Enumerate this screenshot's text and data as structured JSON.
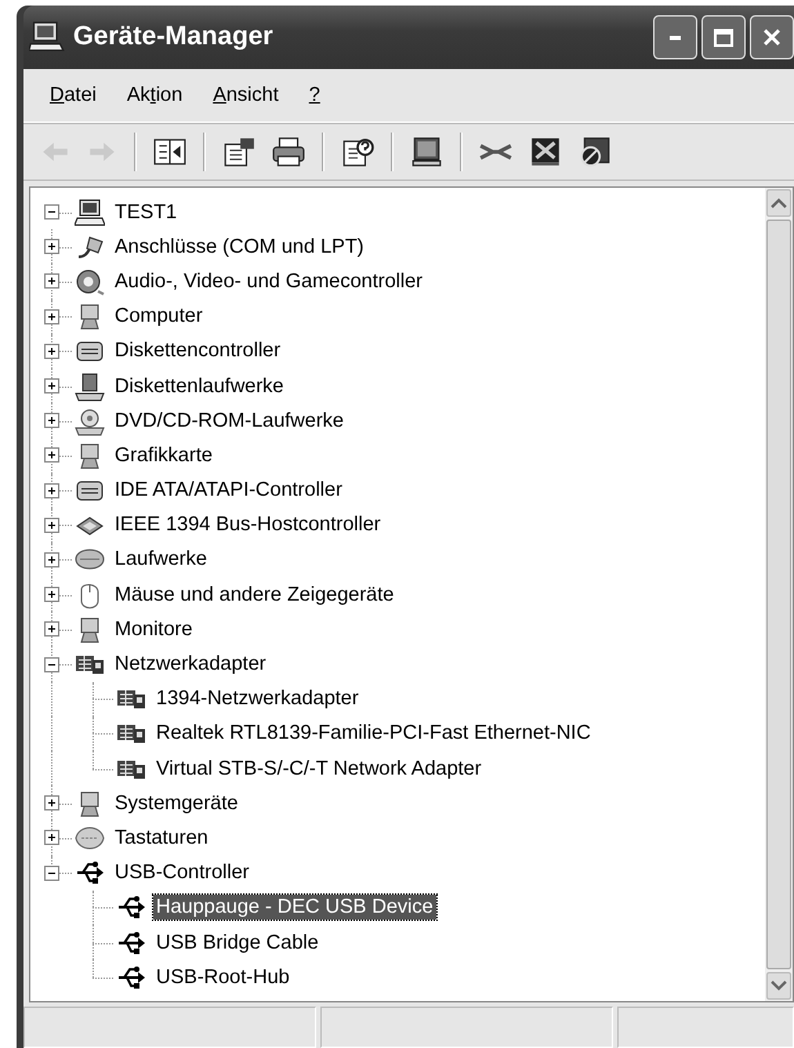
{
  "window": {
    "title": "Geräte-Manager"
  },
  "menu": [
    {
      "key": "D",
      "post": "atei"
    },
    {
      "pre": "Ak",
      "key": "t",
      "post": "ion"
    },
    {
      "key": "A",
      "post": "nsicht"
    },
    {
      "key": "?"
    }
  ],
  "toolbar": [
    {
      "kind": "back",
      "disabled": true
    },
    {
      "kind": "forward",
      "disabled": true
    },
    {
      "kind": "separator"
    },
    {
      "kind": "tree",
      "disabled": false
    },
    {
      "kind": "separator"
    },
    {
      "kind": "properties",
      "disabled": false
    },
    {
      "kind": "print",
      "disabled": false
    },
    {
      "kind": "separator"
    },
    {
      "kind": "help",
      "disabled": false
    },
    {
      "kind": "separator"
    },
    {
      "kind": "scan",
      "disabled": false
    },
    {
      "kind": "separator"
    },
    {
      "kind": "network",
      "disabled": false
    },
    {
      "kind": "uninstall",
      "disabled": false
    },
    {
      "kind": "disable",
      "disabled": false
    }
  ],
  "tree": {
    "label": "TEST1",
    "kind": "computer",
    "expanded": true,
    "selected": false,
    "children": [
      {
        "label": "Anschlüsse (COM und LPT)",
        "kind": "port",
        "expanded": false,
        "selected": false
      },
      {
        "label": "Audio-, Video- und Gamecontroller",
        "kind": "audio",
        "expanded": false,
        "selected": false
      },
      {
        "label": "Computer",
        "kind": "system",
        "expanded": false,
        "selected": false
      },
      {
        "label": "Diskettencontroller",
        "kind": "controller",
        "expanded": false,
        "selected": false
      },
      {
        "label": "Diskettenlaufwerke",
        "kind": "floppy",
        "expanded": false,
        "selected": false
      },
      {
        "label": "DVD/CD-ROM-Laufwerke",
        "kind": "dvd",
        "expanded": false,
        "selected": false
      },
      {
        "label": "Grafikkarte",
        "kind": "system",
        "expanded": false,
        "selected": false
      },
      {
        "label": "IDE ATA/ATAPI-Controller",
        "kind": "controller",
        "expanded": false,
        "selected": false
      },
      {
        "label": "IEEE 1394 Bus-Hostcontroller",
        "kind": "chip",
        "expanded": false,
        "selected": false
      },
      {
        "label": "Laufwerke",
        "kind": "drive",
        "expanded": false,
        "selected": false
      },
      {
        "label": "Mäuse und andere Zeigegeräte",
        "kind": "mouse",
        "expanded": false,
        "selected": false
      },
      {
        "label": "Monitore",
        "kind": "system",
        "expanded": false,
        "selected": false
      },
      {
        "label": "Netzwerkadapter",
        "kind": "network",
        "expanded": true,
        "selected": false,
        "children": [
          {
            "label": "1394-Netzwerkadapter",
            "kind": "network",
            "selected": false
          },
          {
            "label": "Realtek RTL8139-Familie-PCI-Fast Ethernet-NIC",
            "kind": "network",
            "selected": false
          },
          {
            "label": "Virtual STB-S/-C/-T Network Adapter",
            "kind": "network",
            "selected": false
          }
        ]
      },
      {
        "label": "Systemgeräte",
        "kind": "system",
        "expanded": false,
        "selected": false
      },
      {
        "label": "Tastaturen",
        "kind": "keyboard",
        "expanded": false,
        "selected": false
      },
      {
        "label": "USB-Controller",
        "kind": "usb",
        "expanded": true,
        "selected": false,
        "children": [
          {
            "label": "Hauppauge - DEC USB Device",
            "kind": "usb",
            "selected": true
          },
          {
            "label": "USB Bridge Cable",
            "kind": "usb",
            "selected": false
          },
          {
            "label": "USB-Root-Hub",
            "kind": "usb",
            "selected": false
          }
        ]
      }
    ]
  }
}
